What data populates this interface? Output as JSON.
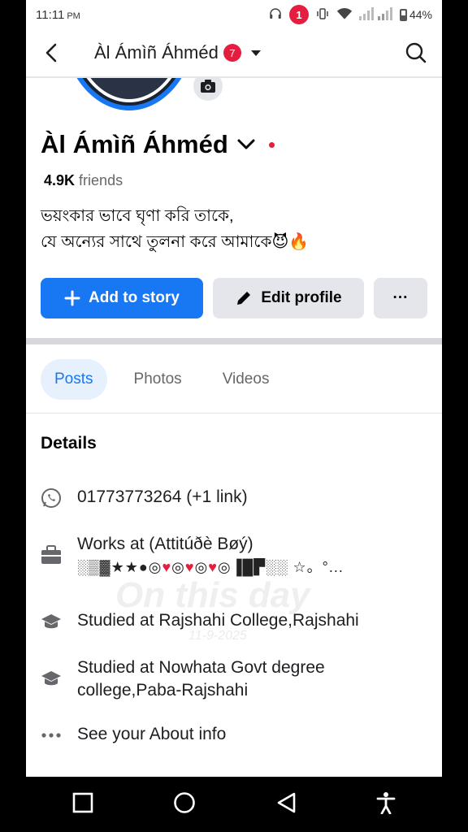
{
  "status_bar": {
    "time": "11:11",
    "ampm": "PM",
    "notification_count": "1",
    "battery": "44%"
  },
  "header": {
    "title": "Àl Ámìñ Áhméd",
    "badge_count": "7"
  },
  "profile": {
    "name": "Àl Ámìñ Áhméd",
    "friends_count": "4.9K",
    "friends_label": "friends",
    "bio_line1": "ভয়ংকার ভাবে ঘৃণা করি তাকে,",
    "bio_line2": "যে অন্যের সাথে তুলনা করে আমাকে😈🔥"
  },
  "actions": {
    "add_story": "Add to story",
    "edit_profile": "Edit profile",
    "more": "···"
  },
  "tabs": [
    {
      "label": "Posts",
      "active": true
    },
    {
      "label": "Photos",
      "active": false
    },
    {
      "label": "Videos",
      "active": false
    }
  ],
  "details": {
    "title": "Details",
    "phone": "01773773264 (+1 link)",
    "work": "Works at (Attitúðè Bøý)",
    "work_deco_a": "░▒▓★★●◎",
    "work_deco_b": "◎",
    "work_deco_c": "◎",
    "work_deco_d": "◎▐█▛░░ ☆。°...",
    "study1": "Studied at Rajshahi College,Rajshahi",
    "study2_line1": "Studied at Nowhata Govt degree",
    "study2_line2": "college,Paba-Rajshahi",
    "about": "See your About info"
  },
  "watermark": {
    "text": "On this day",
    "date": "11-9-2025"
  },
  "colors": {
    "accent": "#1877f2",
    "badge": "#e41e3f",
    "secondary_text": "#65676b"
  }
}
